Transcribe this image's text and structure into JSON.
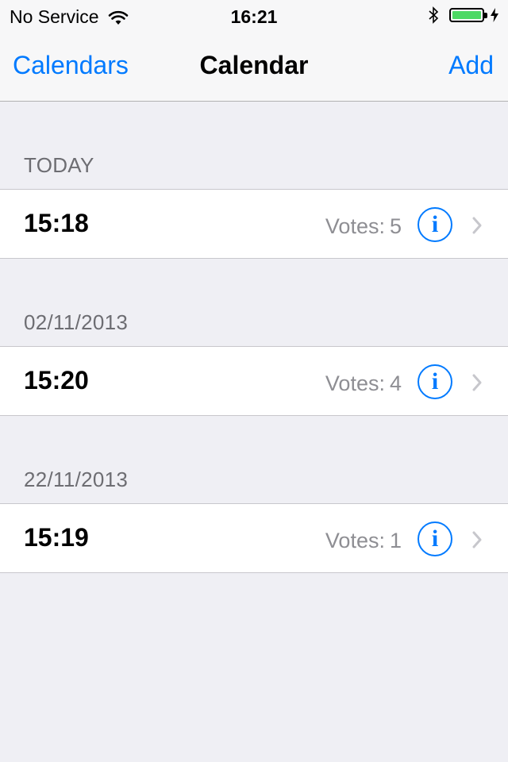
{
  "status_bar": {
    "carrier": "No Service",
    "time": "16:21",
    "battery_level": 1.0,
    "battery_color": "#4cd964"
  },
  "nav": {
    "back_label": "Calendars",
    "title": "Calendar",
    "add_label": "Add"
  },
  "votes_label": "Votes:",
  "sections": [
    {
      "header": "TODAY",
      "row": {
        "time": "15:18",
        "votes": "5"
      }
    },
    {
      "header": "02/11/2013",
      "row": {
        "time": "15:20",
        "votes": "4"
      }
    },
    {
      "header": "22/11/2013",
      "row": {
        "time": "15:19",
        "votes": "1"
      }
    }
  ],
  "info_glyph": "i",
  "icons": [
    "wifi-icon",
    "bluetooth-icon",
    "battery-icon",
    "charging-bolt-icon",
    "info-icon",
    "chevron-right-icon"
  ],
  "accent_color": "#007aff"
}
